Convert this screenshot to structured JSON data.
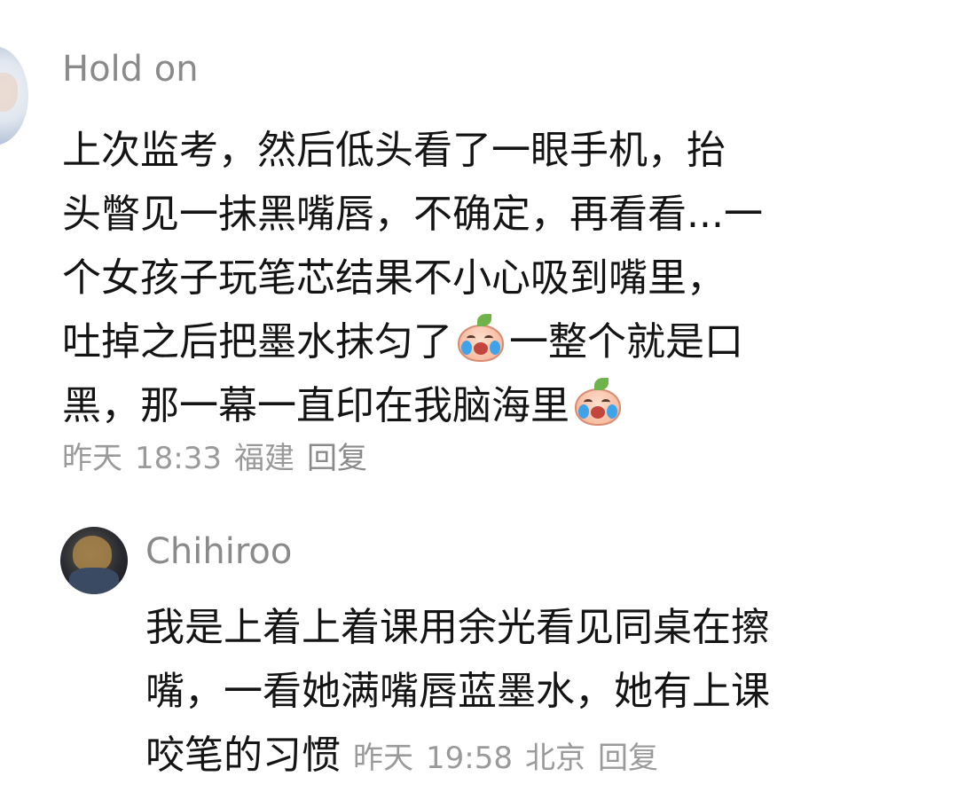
{
  "comment": {
    "username": "Hold on",
    "lines": [
      "上次监考，然后低头看了一眼手机，抬",
      "头瞥见一抹黑嘴唇，不确定，再看看...一",
      "个女孩子玩笔芯结果不小心吸到嘴里，",
      "吐掉之后把墨水抹匀了",
      "一整个就是口",
      "黑，那一幕一直印在我脑海里"
    ],
    "emoji_icon": "crying-emoji",
    "meta": {
      "date": "昨天",
      "time": "18:33",
      "location": "福建",
      "reply": "回复"
    }
  },
  "reply": {
    "username": "Chihiroo",
    "lines": [
      "我是上着上着课用余光看见同桌在擦",
      "嘴，一看她满嘴唇蓝墨水，她有上课",
      "咬笔的习惯"
    ],
    "meta": {
      "date": "昨天",
      "time": "19:58",
      "location": "北京",
      "reply": "回复"
    }
  },
  "colors": {
    "username": "#8a8a8a",
    "body_text": "#141414",
    "meta_text": "#9a9a9a"
  }
}
